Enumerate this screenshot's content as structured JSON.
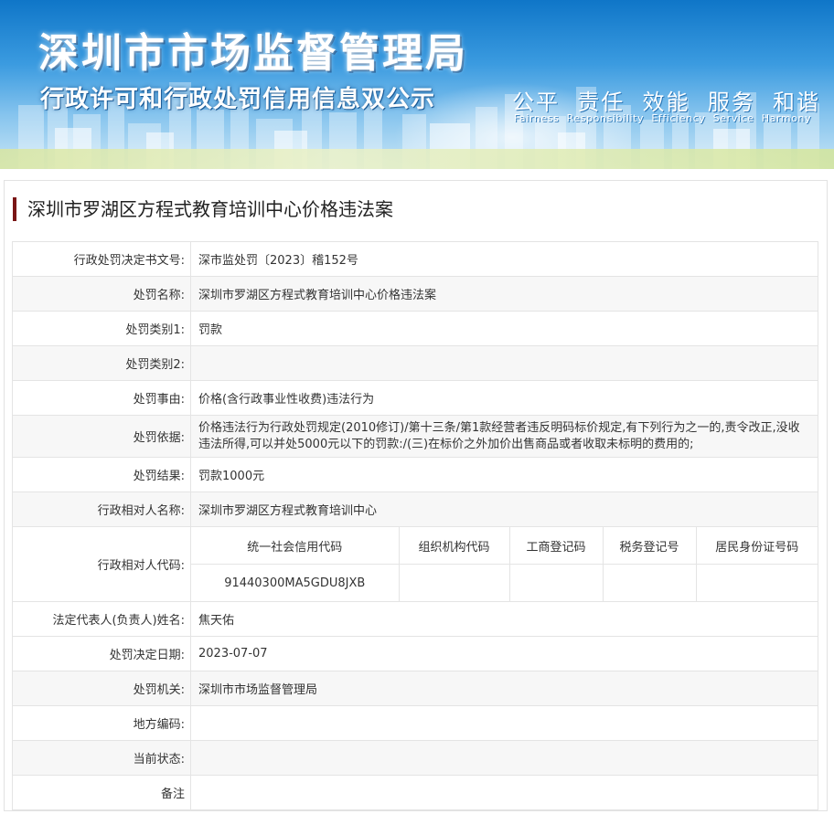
{
  "header": {
    "title": "深圳市市场监督管理局",
    "subtitle": "行政许可和行政处罚信用信息双公示",
    "slogan_cn": "公平  责任  效能  服务  和谐",
    "slogan_en": "Fairness  Responsibility  Efficiency  Service  Harmony"
  },
  "case": {
    "title": "深圳市罗湖区方程式教育培训中心价格违法案"
  },
  "fields": {
    "decision_no": {
      "label": "行政处罚决定书文号:",
      "value": "深市监处罚〔2023〕稽152号"
    },
    "penalty_name": {
      "label": "处罚名称:",
      "value": "深圳市罗湖区方程式教育培训中心价格违法案"
    },
    "penalty_type1": {
      "label": "处罚类别1:",
      "value": "罚款"
    },
    "penalty_type2": {
      "label": "处罚类别2:",
      "value": ""
    },
    "reason": {
      "label": "处罚事由:",
      "value": "价格(含行政事业性收费)违法行为"
    },
    "basis": {
      "label": "处罚依据:",
      "value": "价格违法行为行政处罚规定(2010修订)/第十三条/第1款经营者违反明码标价规定,有下列行为之一的,责令改正,没收违法所得,可以并处5000元以下的罚款:/(三)在标价之外加价出售商品或者收取未标明的费用的;"
    },
    "result": {
      "label": "处罚结果:",
      "value": "罚款1000元"
    },
    "party_name": {
      "label": "行政相对人名称:",
      "value": "深圳市罗湖区方程式教育培训中心"
    },
    "party_code": {
      "label": "行政相对人代码:",
      "headers": [
        "统一社会信用代码",
        "组织机构代码",
        "工商登记码",
        "税务登记号",
        "居民身份证号码"
      ],
      "values": [
        "91440300MA5GDU8JXB",
        "",
        "",
        "",
        ""
      ]
    },
    "legal_rep": {
      "label": "法定代表人(负责人)姓名:",
      "value": "焦天佑"
    },
    "decision_date": {
      "label": "处罚决定日期:",
      "value": "2023-07-07"
    },
    "authority": {
      "label": "处罚机关:",
      "value": "深圳市市场监督管理局"
    },
    "region_code": {
      "label": "地方编码:",
      "value": ""
    },
    "status": {
      "label": "当前状态:",
      "value": ""
    },
    "remark": {
      "label": "备注",
      "value": ""
    }
  },
  "colors": {
    "title_bar": "#7a1515",
    "banner_top": "#0f76c8",
    "row_alt": "#f7f7f7"
  }
}
